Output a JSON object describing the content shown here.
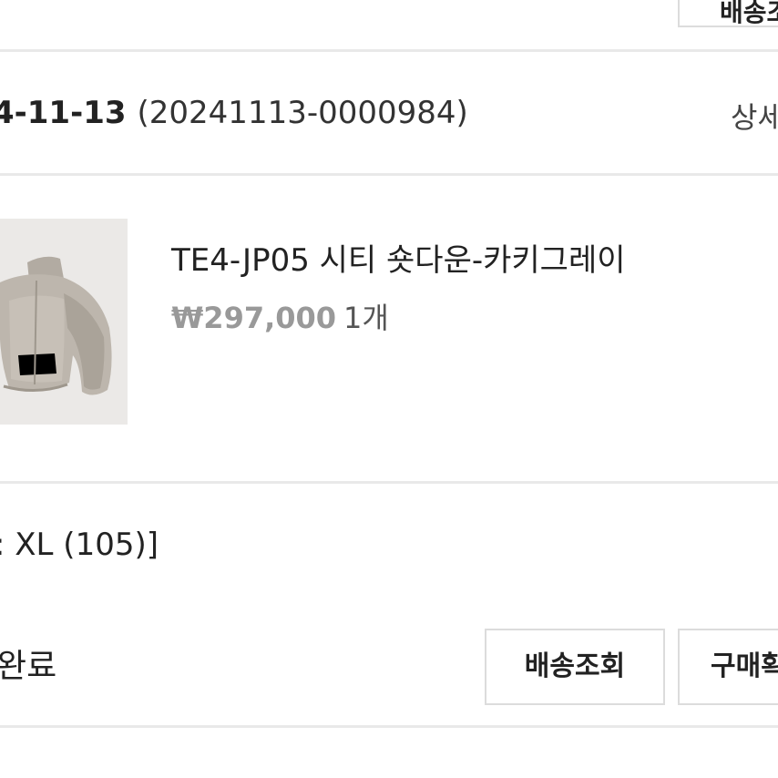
{
  "top_button": {
    "label": "배송조"
  },
  "order": {
    "date": "4-11-13",
    "number": "(20241113-0000984)",
    "detail_label": "상세"
  },
  "product": {
    "name": "TE4-JP05 시티 숏다운-카키그레이",
    "price": "₩297,000",
    "quantity": "1개",
    "image_alt_icon": "product-thumbnail"
  },
  "option": {
    "text": ": XL (105)]"
  },
  "status": {
    "text": "완료"
  },
  "actions": {
    "track_label": "배송조회",
    "confirm_label": "구매확"
  },
  "colors": {
    "divider": "#e9e9e9",
    "button_border": "#dcdcdc",
    "price_text": "#999999",
    "image_background": "#ebe9e7"
  }
}
